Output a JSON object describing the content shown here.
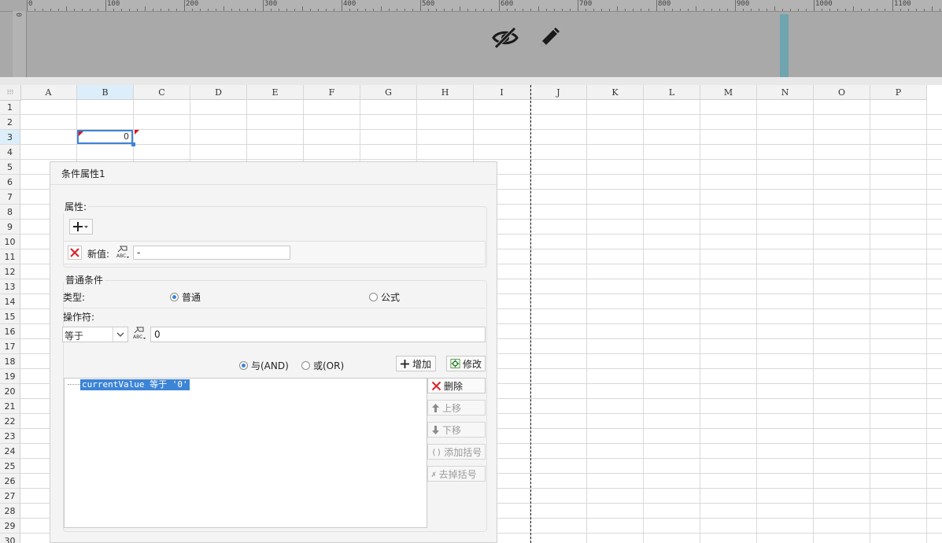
{
  "ruler": {
    "vertical_label": "0",
    "marks": [
      "0",
      "100",
      "200",
      "300",
      "400",
      "500",
      "600",
      "700",
      "800",
      "900",
      "1000",
      "1100"
    ]
  },
  "toolbar": {
    "hide_icon": "eye-slash-icon",
    "edit_icon": "pencil-icon"
  },
  "grid": {
    "columns": [
      "A",
      "B",
      "C",
      "D",
      "E",
      "F",
      "G",
      "H",
      "I",
      "J",
      "K",
      "L",
      "M",
      "N",
      "O",
      "P"
    ],
    "selected_column": "B",
    "rows": [
      "1",
      "2",
      "3",
      "4",
      "5",
      "6",
      "7",
      "8",
      "9",
      "10",
      "11",
      "12",
      "13",
      "14",
      "15",
      "16",
      "17",
      "18",
      "19",
      "20",
      "21",
      "22",
      "23",
      "24",
      "25",
      "26",
      "27",
      "28",
      "29",
      "30"
    ],
    "selected_row": "3",
    "selected_cell_value": "0"
  },
  "dialog": {
    "title": "条件属性1",
    "attributes": {
      "label": "属性:",
      "new_value_label": "新值:",
      "new_value": "-"
    },
    "common": {
      "label": "普通条件",
      "type_label": "类型:",
      "type_options": [
        "普通",
        "公式"
      ],
      "type_selected": "普通",
      "operator_label": "操作符:",
      "operator_value": "等于",
      "operand_value": "0",
      "join_options": [
        "与(AND)",
        "或(OR)"
      ],
      "join_selected": "与(AND)",
      "add_label": "增加",
      "modify_label": "修改",
      "delete_label": "删除",
      "move_up_label": "上移",
      "move_down_label": "下移",
      "add_bracket_label": "添加括号",
      "remove_bracket_label": "去掉括号",
      "conditions": [
        "currentValue 等于 '0'"
      ]
    }
  }
}
